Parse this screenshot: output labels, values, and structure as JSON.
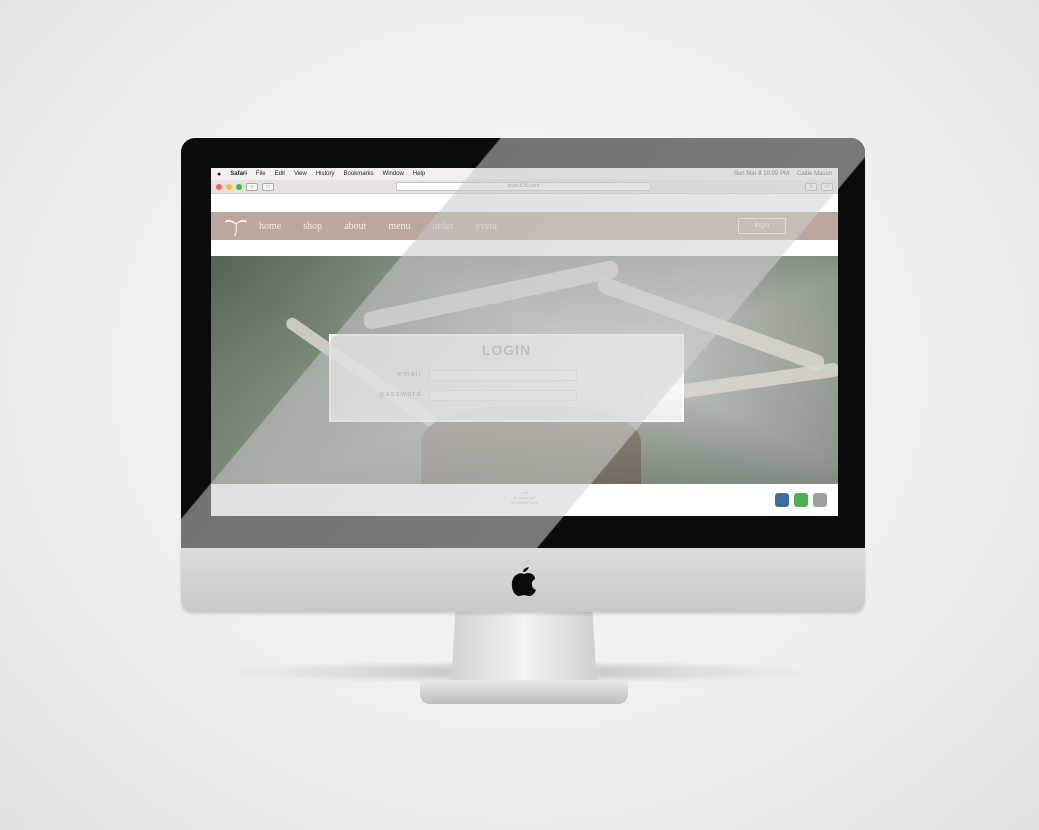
{
  "mac_menubar": {
    "apple": "",
    "app": "Safari",
    "items": [
      "File",
      "Edit",
      "View",
      "History",
      "Bookmarks",
      "Window",
      "Help"
    ],
    "status": "Sun Mar 8 10:05 PM",
    "user": "Caitie Mason"
  },
  "browser": {
    "url": "www.b2tll.com"
  },
  "site": {
    "nav": [
      "home",
      "shop",
      "about",
      "menu",
      "order",
      "event"
    ],
    "login_button": "login"
  },
  "login_form": {
    "title": "LOGIN",
    "email_label": "email",
    "password_label": "password"
  },
  "footer": {
    "lines": [
      "b2tll",
      "© Copyright",
      "info@b2tll.com"
    ]
  },
  "colors": {
    "nav_bg": "#b9a89b",
    "accent": "#b9a89b",
    "facebook": "#3b6e9e",
    "whatsapp": "#4caf50",
    "instagram": "#9e9e9e"
  },
  "icons": [
    "palm-tree-logo-icon",
    "facebook-icon",
    "whatsapp-icon",
    "instagram-icon",
    "apple-logo-icon"
  ]
}
